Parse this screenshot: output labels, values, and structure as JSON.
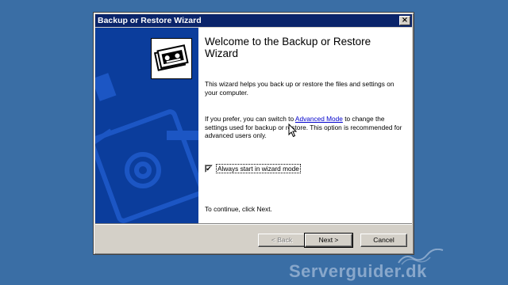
{
  "window": {
    "title": "Backup or Restore Wizard",
    "close_glyph": "×"
  },
  "content": {
    "heading": "Welcome to the Backup or Restore Wizard",
    "intro": "This wizard helps you back up or restore the files and settings on your computer.",
    "advanced_prefix": "If you prefer, you can switch to ",
    "advanced_link": "Advanced Mode",
    "advanced_suffix": " to change the settings used for backup or restore. This option is recommended for advanced users only.",
    "checkbox_label": "Always start in wizard mode",
    "checkbox_checked": true,
    "checkbox_glyph": "✔",
    "continue_text": "To continue, click Next."
  },
  "buttons": {
    "back": "< Back",
    "next": "Next >",
    "cancel": "Cancel"
  },
  "watermark": "Serverguider.dk",
  "colors": {
    "desktop": "#3a6ea5",
    "titlebar": "#0a246a",
    "side_panel": "#0b3d9c",
    "link": "#0000cc"
  },
  "icons": {
    "wizard": "backup-tape-icon",
    "cursor": "mouse-pointer-icon"
  }
}
